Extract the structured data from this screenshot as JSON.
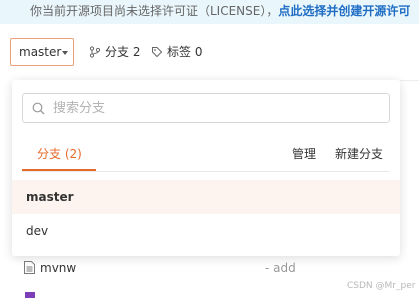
{
  "notice": {
    "text": "你当前开源项目尚未选择许可证（LICENSE），",
    "link": "点此选择并创建开源许可"
  },
  "toolbar": {
    "branch_select": "master",
    "branches_stat": "分支 2",
    "tags_stat": "标签 0"
  },
  "dropdown": {
    "search_placeholder": "搜索分支",
    "tab_branches": "分支 (2)",
    "manage_link": "管理",
    "new_branch_link": "新建分支",
    "branches": [
      {
        "name": "master",
        "active": true
      },
      {
        "name": "dev",
        "active": false
      }
    ]
  },
  "files": [
    {
      "name": "mvnw",
      "message": "- add",
      "icon": "file-icon"
    }
  ],
  "watermark": "CSDN @Mr_per",
  "colors": {
    "accent": "#e76a2c",
    "notice_bg": "#e9f6fb",
    "link": "#1f6ec4",
    "active_row_bg": "#fdf4ef"
  }
}
